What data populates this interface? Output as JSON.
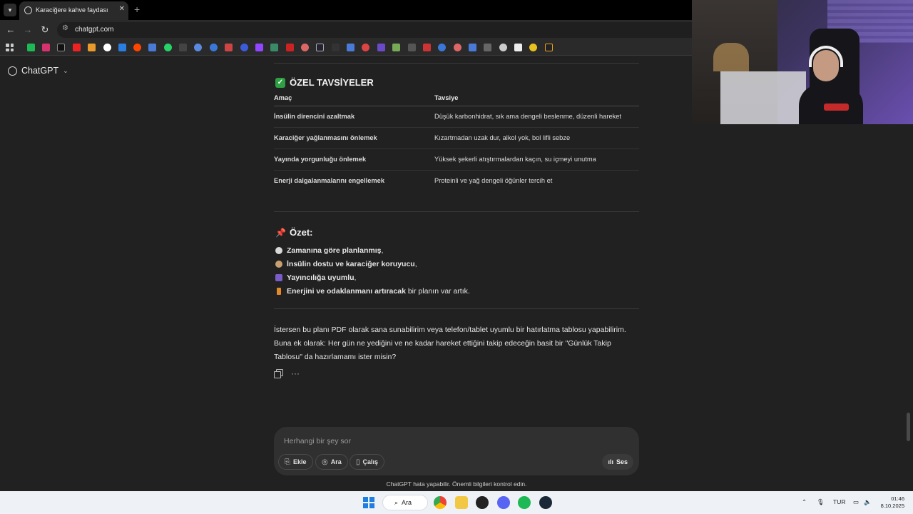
{
  "browser": {
    "tab_title": "Karaciğere kahve faydası",
    "url": "chatgpt.com",
    "new_tab_symbol": "+",
    "close_symbol": "✕"
  },
  "chat": {
    "model_name": "ChatGPT"
  },
  "advice": {
    "heading": "ÖZEL TAVSİYELER",
    "columns": [
      "Amaç",
      "Tavsiye"
    ],
    "rows": [
      {
        "goal": "İnsülin direncini azaltmak",
        "advice": "Düşük karbonhidrat, sık ama dengeli beslenme, düzenli hareket"
      },
      {
        "goal": "Karaciğer yağlanmasını önlemek",
        "advice": "Kızartmadan uzak dur, alkol yok, bol lifli sebze"
      },
      {
        "goal": "Yayında yorgunluğu önlemek",
        "advice": "Yüksek şekerli atıştırmalardan kaçın, su içmeyi unutma"
      },
      {
        "goal": "Enerji dalgalanmalarını engellemek",
        "advice": "Proteinli ve yağ dengeli öğünler tercih et"
      }
    ]
  },
  "summary": {
    "heading": "Özet:",
    "items": [
      {
        "bold": "Zamanına göre planlanmış",
        "rest": ",",
        "icon": "clock-icon",
        "color": "#d9d9d9"
      },
      {
        "bold": "İnsülin dostu ve karaciğer koruyucu",
        "rest": ",",
        "icon": "bowl-icon",
        "color": "#c8a070"
      },
      {
        "bold": "Yayıncılığa uyumlu",
        "rest": ",",
        "icon": "gamepad-icon",
        "color": "#7a5cc8"
      },
      {
        "bold": "Enerjini ve odaklanmanı artıracak",
        "rest": " bir planın var artık.",
        "icon": "lightning-icon",
        "color": "#e08a2a"
      }
    ]
  },
  "followup": "İstersen bu planı PDF olarak sana sunabilirim veya telefon/tablet uyumlu bir hatırlatma tablosu yapabilirim. Buna ek olarak: Her gün ne yediğini ve ne kadar hareket ettiğini takip edeceğin basit bir \"Günlük Takip Tablosu\" da hazırlamamı ister misin?",
  "composer": {
    "placeholder": "Herhangi bir şey sor",
    "attach": "Ekle",
    "search": "Ara",
    "study": "Çalış",
    "voice": "Ses"
  },
  "disclaimer": "ChatGPT hata yapabilir. Önemli bilgileri kontrol edin.",
  "taskbar": {
    "search_label": "Ara",
    "language": "TUR",
    "time": "01:46",
    "date": "8.10.2025"
  },
  "colors": {
    "background": "#212121",
    "check_green": "#2ea043",
    "taskbar": "#eef1f6"
  }
}
